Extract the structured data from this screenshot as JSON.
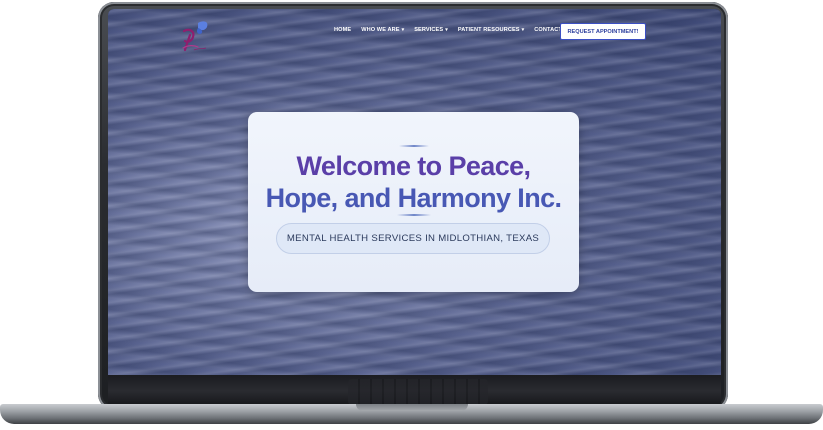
{
  "header": {
    "logo_icon": "butterfly-logo-icon",
    "nav": [
      {
        "label": "HOME",
        "has_dropdown": false
      },
      {
        "label": "WHO WE ARE",
        "has_dropdown": true
      },
      {
        "label": "SERVICES",
        "has_dropdown": true
      },
      {
        "label": "PATIENT RESOURCES",
        "has_dropdown": true
      },
      {
        "label": "CONTACT US",
        "has_dropdown": false
      }
    ],
    "cta_label": "REQUEST APPOINTMENT!"
  },
  "hero": {
    "title_line1": "Welcome to Peace,",
    "title_line2": "Hope, and Harmony Inc.",
    "subtitle": "MENTAL HEALTH SERVICES IN MIDLOTHIAN, TEXAS"
  },
  "colors": {
    "title_purple": "#5a3fa8",
    "title_blue": "#4858b4",
    "cta_border": "#3b4fc4"
  }
}
